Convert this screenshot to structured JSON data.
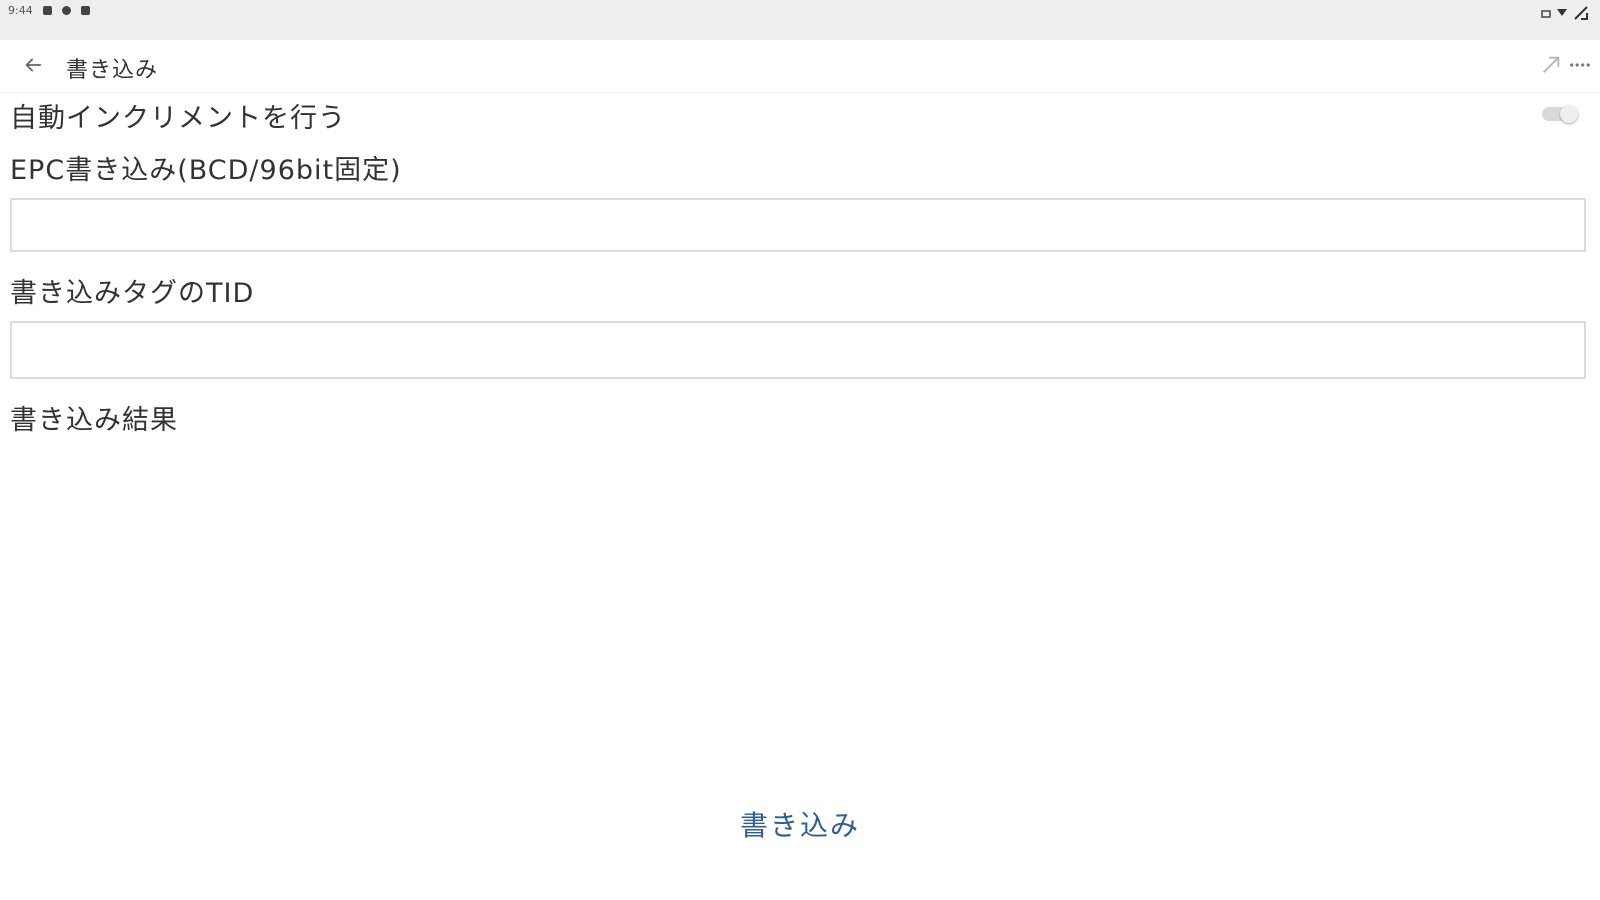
{
  "status_bar": {
    "time": "9:44",
    "icons": [
      "notification-icon",
      "sync-icon",
      "lock-icon",
      "sim-icon",
      "wifi-icon",
      "battery-icon"
    ]
  },
  "toolbar": {
    "title": "書き込み",
    "icons": [
      "back-arrow-icon",
      "signal-icon",
      "more-icon"
    ]
  },
  "settings": {
    "auto_increment_label": "自動インクリメントを行う",
    "auto_increment_on": false
  },
  "form": {
    "epc_label": "EPC書き込み(BCD/96bit固定)",
    "epc_value": "",
    "tid_label": "書き込みタグのTID",
    "tid_value": "",
    "result_label": "書き込み結果"
  },
  "actions": {
    "write_label": "書き込み"
  },
  "colors": {
    "accent": "#2f5d95",
    "status_bar_bg": "#eeeeee",
    "field_border": "#dcdcdc"
  }
}
